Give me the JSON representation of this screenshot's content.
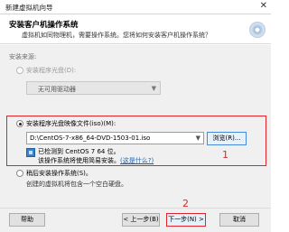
{
  "window": {
    "title": "新建虚拟机向导",
    "close_glyph": "✕"
  },
  "header": {
    "title": "安装客户机操作系统",
    "subtitle": "虚拟机如同物理机，需要操作系统。您将如何安装客户机操作系统？",
    "icon": "disc-icon"
  },
  "source_label": "安装来源:",
  "options": {
    "drive": {
      "label": "安装程序光盘(D):",
      "selected": false,
      "enabled": false,
      "combo_value": "无可用驱动器",
      "arrow_glyph": "▼"
    },
    "iso": {
      "label": "安装程序光盘映像文件(iso)(M):",
      "selected": true,
      "path_value": "D:\\CentOS-7-x86_64-DVD-1503-01.iso",
      "arrow_glyph": "▼",
      "browse_label": "浏览(R)...",
      "detected_line": "已检测到 CentOS 7 64 位。",
      "easy_install_text": "该操作系统将使用简易安装。",
      "easy_install_link": "(这是什么?)"
    },
    "later": {
      "label": "稍后安装操作系统(S)。",
      "selected": false,
      "description": "创建的虚拟机将包含一个空白硬盘。"
    }
  },
  "annotations": {
    "box_number": "1",
    "next_number": "2",
    "color": "#e3232c"
  },
  "footer": {
    "help_label": "帮助",
    "back_label": "< 上一步(B)",
    "next_label": "下一步(N) >",
    "cancel_label": "取消"
  }
}
